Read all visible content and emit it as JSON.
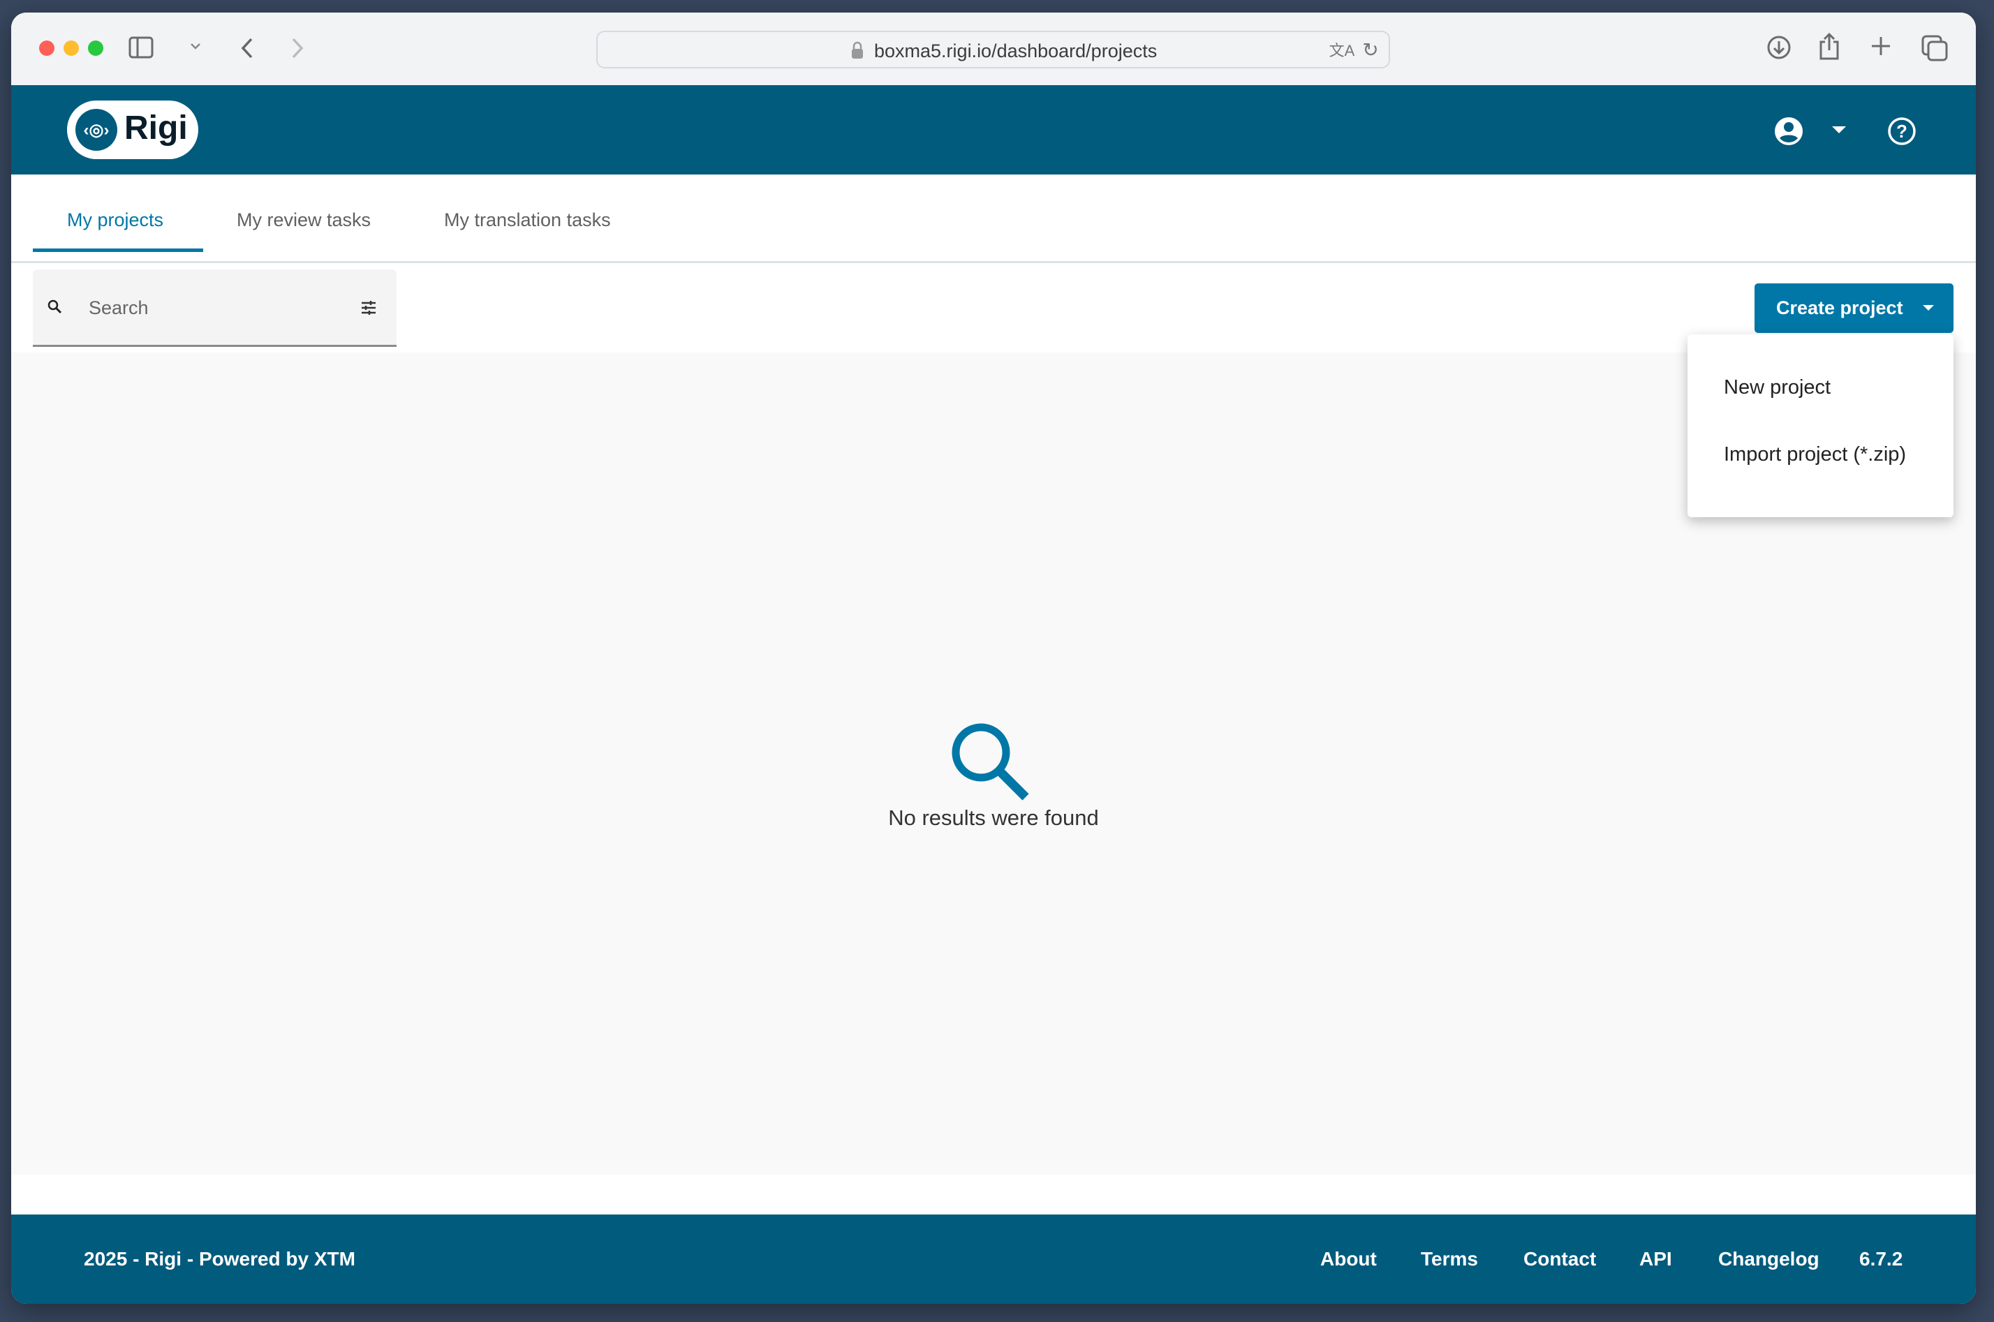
{
  "browser": {
    "url": "boxma5.rigi.io/dashboard/projects"
  },
  "header": {
    "logo_text": "Rigi"
  },
  "tabs": [
    {
      "label": "My projects",
      "active": true
    },
    {
      "label": "My review tasks"
    },
    {
      "label": "My translation tasks"
    }
  ],
  "search": {
    "placeholder": "Search"
  },
  "create_button": {
    "label": "Create project"
  },
  "create_menu": {
    "items": [
      "New project",
      "Import project (*.zip)"
    ]
  },
  "empty_state": {
    "message": "No results were found"
  },
  "footer": {
    "copyright": "2025 - Rigi - Powered by XTM",
    "links": [
      "About",
      "Terms",
      "Contact",
      "API",
      "Changelog"
    ],
    "version": "6.7.2"
  },
  "colors": {
    "brand": "#015b7d",
    "accent": "#0077a6"
  }
}
